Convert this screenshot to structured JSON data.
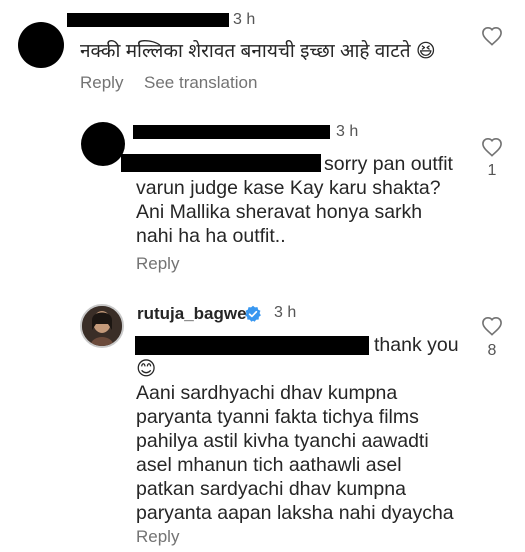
{
  "comments": [
    {
      "time": "3 h",
      "text": "नक्की मल्लिका शेरावत बनायची इच्छा आहे वाटते 😆",
      "reply_label": "Reply",
      "translation_label": "See translation",
      "like_icon": "heart-outline-icon"
    },
    {
      "time": "3 h",
      "text_inline": "sorry pan outfit",
      "text_rest": "varun judge kase Kay karu shakta?\nAni Mallika sheravat honya sarkh\nnahi ha ha outfit..",
      "reply_label": "Reply",
      "like_count": "1",
      "like_icon": "heart-outline-icon"
    },
    {
      "username": "rutuja_bagwe",
      "verified_icon": "verified-badge-icon",
      "time": "3 h",
      "text_inline": "thank you",
      "text_rest": "😊\nAani sardhyachi dhav kumpna\nparyanta tyanni fakta tichya films\npahilya astil kivha tyanchi aawadti\nasel mhanun tich aathawli asel\npatkan sardyachi dhav kumpna\nparyanta aapan laksha nahi dyaycha",
      "reply_label": "Reply",
      "like_count": "8",
      "like_icon": "heart-outline-icon"
    }
  ],
  "colors": {
    "verified": "#3897f0",
    "secondary_text": "#737373",
    "redaction": "#000000"
  }
}
